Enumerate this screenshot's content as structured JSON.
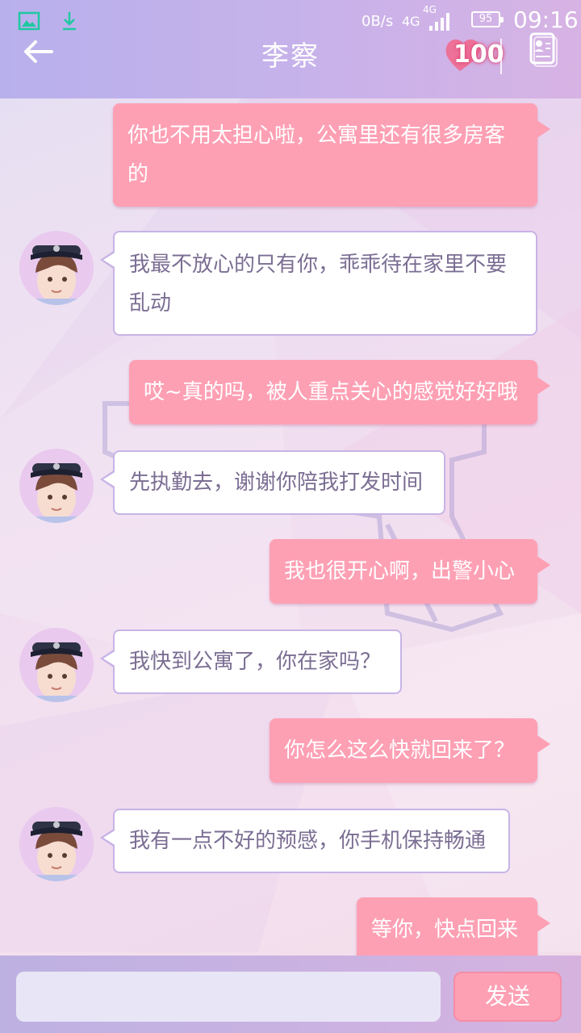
{
  "status_bar": {
    "net_speed": "0B/s",
    "net_type_top": "4G",
    "net_type_bottom": "4G",
    "battery": "95",
    "time": "09:16"
  },
  "header": {
    "title": "李察",
    "affection": "100",
    "back_icon": "back-arrow-icon",
    "contact_icon": "contact-card-icon"
  },
  "messages": [
    {
      "from": "me",
      "lines": [
        "你也不用太担心啦，公寓里还有很多房客",
        "的"
      ]
    },
    {
      "from": "them",
      "lines": [
        "我最不放心的只有你，乖乖待在家里不要",
        "乱动"
      ]
    },
    {
      "from": "me",
      "lines": [
        "哎~真的吗，被人重点关心的感觉好好哦"
      ]
    },
    {
      "from": "them",
      "lines": [
        "先执勤去，谢谢你陪我打发时间"
      ]
    },
    {
      "from": "me",
      "lines": [
        "我也很开心啊，出警小心"
      ]
    },
    {
      "from": "them",
      "lines": [
        "我快到公寓了，你在家吗？"
      ]
    },
    {
      "from": "me",
      "lines": [
        "你怎么这么快就回来了？"
      ]
    },
    {
      "from": "them",
      "lines": [
        "我有一点不好的预感，你手机保持畅通"
      ]
    },
    {
      "from": "me",
      "lines": [
        "等你，快点回来"
      ]
    }
  ],
  "composer": {
    "input_value": "",
    "send_label": "发送"
  },
  "colors": {
    "accent_pink": "#fea0b4",
    "header_purple": "#c6b2ea",
    "text_them": "#7b6e93"
  }
}
